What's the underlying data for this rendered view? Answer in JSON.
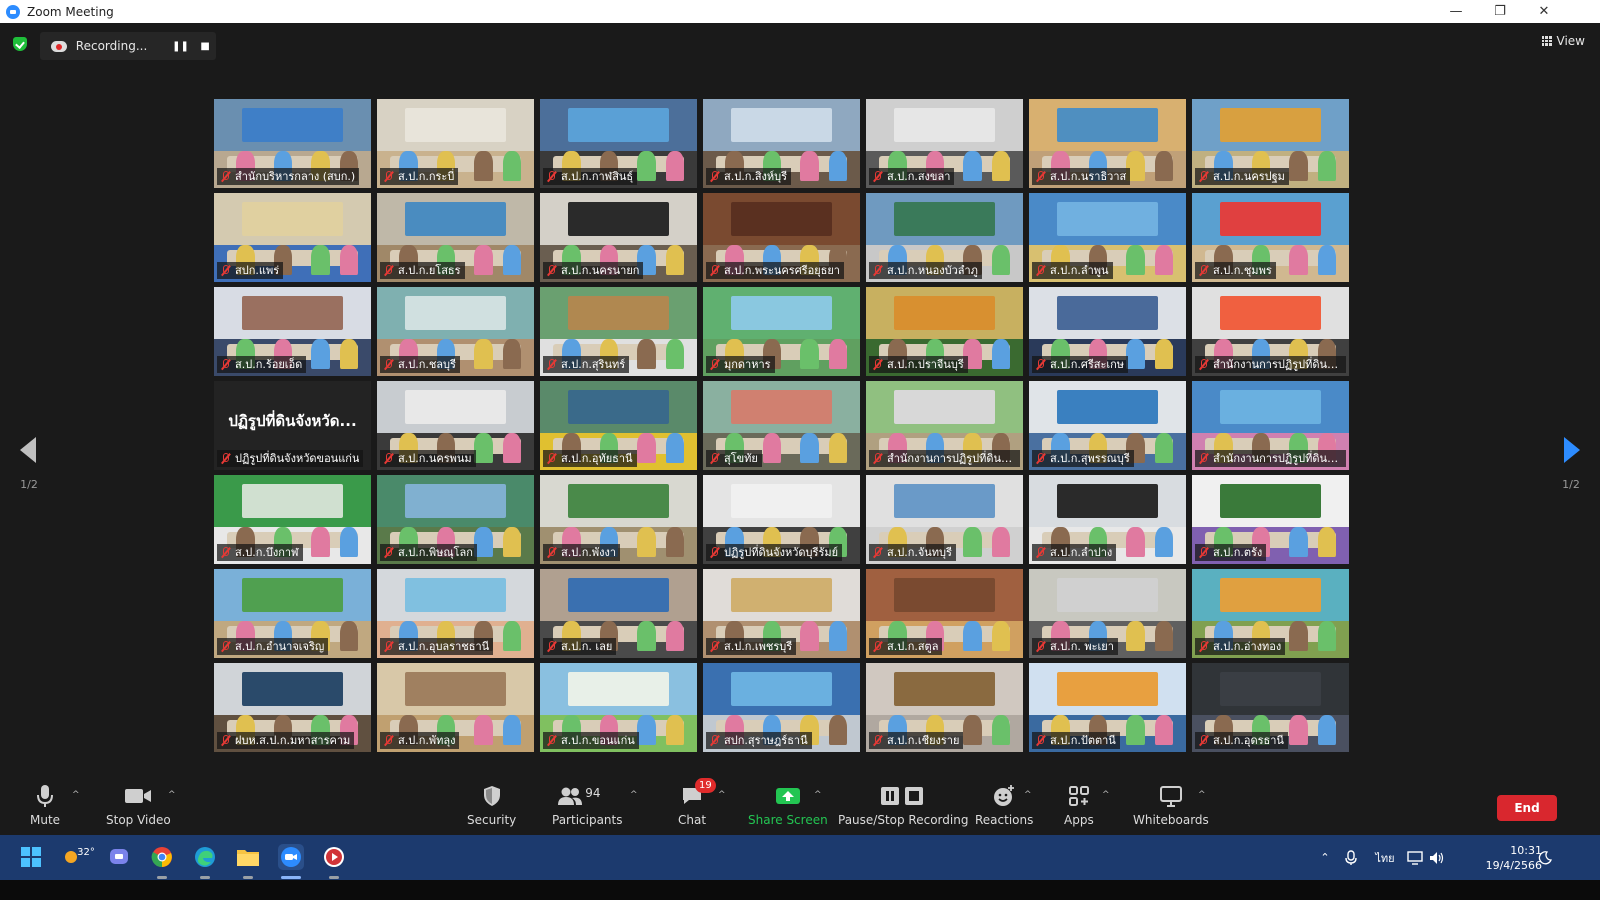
{
  "window": {
    "title": "Zoom Meeting"
  },
  "topbar": {
    "recording_label": "Recording...",
    "view_label": "View"
  },
  "pagination": {
    "left": "1/2",
    "right": "1/2"
  },
  "tiles": [
    {
      "name": "สำนักบริหารกลาง (สบก.)",
      "wall": "#6a8fb0",
      "floor": "#b8a890",
      "banner": "#3f7fc7",
      "active": true
    },
    {
      "name": "ส.ป.ก.กระบี่",
      "wall": "#d8d2c4",
      "floor": "#c9b28e",
      "banner": "#e8e4da"
    },
    {
      "name": "ส.ป.ก.กาฬสินธุ์",
      "wall": "#4c6f9a",
      "floor": "#3a3a3a",
      "banner": "#5aa0d6"
    },
    {
      "name": "ส.ป.ก.สิงห์บุรี",
      "wall": "#8fa8c0",
      "floor": "#6b5a4a",
      "banner": "#c9d8e6"
    },
    {
      "name": "ส.ป.ก.สงขลา",
      "wall": "#cfcfcf",
      "floor": "#5a5a5a",
      "banner": "#e6e6e6"
    },
    {
      "name": "ส.ป.ก.นราธิวาส",
      "wall": "#d8b070",
      "floor": "#c0a078",
      "banner": "#4f8fc0"
    },
    {
      "name": "ส.ป.ก.นครปฐม",
      "wall": "#6fa0c8",
      "floor": "#c0b080",
      "banner": "#d8a040"
    },
    {
      "name": "สปก.แพร่",
      "wall": "#d4cab0",
      "floor": "#3f6fb8",
      "banner": "#e0d0a0"
    },
    {
      "name": "ส.ป.ก.ยโสธร",
      "wall": "#bfb8a8",
      "floor": "#a08868",
      "banner": "#4a8cc0"
    },
    {
      "name": "ส.ป.ก.นครนายก",
      "wall": "#d4d0c8",
      "floor": "#6a5e50",
      "banner": "#2a2a2a"
    },
    {
      "name": "ส.ป.ก.พระนครศรีอยุธยา",
      "wall": "#7a4a30",
      "floor": "#8a6a50",
      "banner": "#5a3020"
    },
    {
      "name": "ส.ป.ก.หนองบัวลำภู",
      "wall": "#6f9ac0",
      "floor": "#c8c8c8",
      "banner": "#3a7a5a"
    },
    {
      "name": "ส.ป.ก.ลำพูน",
      "wall": "#4a8ac8",
      "floor": "#d8c070",
      "banner": "#70b0e0"
    },
    {
      "name": "ส.ป.ก.ชุมพร",
      "wall": "#5aa0d0",
      "floor": "#d0b890",
      "banner": "#e04040"
    },
    {
      "name": "ส.ป.ก.ร้อยเอ็ด",
      "wall": "#d8dce4",
      "floor": "#3a4a6a",
      "banner": "#9a7060"
    },
    {
      "name": "ส.ป.ก.ชลบุรี",
      "wall": "#7fb0b0",
      "floor": "#b09070",
      "banner": "#d0e0e0"
    },
    {
      "name": "ส.ป.ก.สุรินทร์",
      "wall": "#6aa070",
      "floor": "#e0e0e0",
      "banner": "#b08850"
    },
    {
      "name": "มุกดาหาร",
      "wall": "#60b070",
      "floor": "#60a060",
      "banner": "#8ac8e0"
    },
    {
      "name": "ส.ป.ก.ปราจีนบุรี",
      "wall": "#c8b060",
      "floor": "#3a6a30",
      "banner": "#d89030"
    },
    {
      "name": "ส.ป.ก.ศรีสะเกษ",
      "wall": "#dce0e6",
      "floor": "#2a3a5a",
      "banner": "#4a6a9a"
    },
    {
      "name": "สำนักงานการปฏิรูปที่ดินจ...",
      "wall": "#e0e0e0",
      "floor": "#404040",
      "banner": "#f06040"
    },
    {
      "name": "ปฏิรูปที่ดินจังหวัดขอนแก่น",
      "textonly": true,
      "big": "ปฏิรูปที่ดินจังหวัด..."
    },
    {
      "name": "ส.ป.ก.นครพนม",
      "wall": "#c8ccd0",
      "floor": "#3a3a3a",
      "banner": "#e8e8e8"
    },
    {
      "name": "ส.ป.ก.อุทัยธานี",
      "wall": "#5a8a6a",
      "floor": "#e0c030",
      "banner": "#3a6a8a"
    },
    {
      "name": "สุโขทัย",
      "wall": "#8ab0a0",
      "floor": "#6a6a5a",
      "banner": "#d08070"
    },
    {
      "name": "สำนักงานการปฏิรูปที่ดินจ...",
      "wall": "#90c080",
      "floor": "#b0a080",
      "banner": "#d8d8d8"
    },
    {
      "name": "ส.ป.ก.สุพรรณบุรี",
      "wall": "#e0e4e8",
      "floor": "#4a70a0",
      "banner": "#3a80c0"
    },
    {
      "name": "สำนักงานการปฏิรูปที่ดินจ...",
      "wall": "#4a8ac8",
      "floor": "#d080b0",
      "banner": "#6ab0e0"
    },
    {
      "name": "ส.ป.ก.บึงกาฬ",
      "wall": "#3a9a4a",
      "floor": "#e8e8e8",
      "banner": "#d0e0d0"
    },
    {
      "name": "ส.ป.ก.พิษณุโลก",
      "wall": "#4a8a6a",
      "floor": "#5a7a4a",
      "banner": "#80b0d0"
    },
    {
      "name": "ส.ป.ก.พังงา",
      "wall": "#d8d8d0",
      "floor": "#a09070",
      "banner": "#4a8a4a"
    },
    {
      "name": "ปฏิรูปที่ดินจังหวัดบุรีรัมย์",
      "wall": "#e4e4e4",
      "floor": "#404040",
      "banner": "#f0f0f0"
    },
    {
      "name": "ส.ป.ก.จันทบุรี",
      "wall": "#e0e0e0",
      "floor": "#d0d0d0",
      "banner": "#6a9ac8"
    },
    {
      "name": "ส.ป.ก.ลำปาง",
      "wall": "#d8dce0",
      "floor": "#e8e8e8",
      "banner": "#2a2a2a"
    },
    {
      "name": "ส.ป.ก.ตรัง",
      "wall": "#f0f0f0",
      "floor": "#8060b0",
      "banner": "#3a7a3a"
    },
    {
      "name": "ส.ป.ก.อำนาจเจริญ",
      "wall": "#7ab0d8",
      "floor": "#c0a880",
      "banner": "#50a050"
    },
    {
      "name": "ส.ป.ก.อุบลราชธานี",
      "wall": "#d4d8dc",
      "floor": "#e0b090",
      "banner": "#80c0e0"
    },
    {
      "name": "ส.ป.ก. เลย",
      "wall": "#b0a090",
      "floor": "#4a4a4a",
      "banner": "#3a70b0"
    },
    {
      "name": "ส.ป.ก.เพชรบุรี",
      "wall": "#e0dcd8",
      "floor": "#b09070",
      "banner": "#d0b070"
    },
    {
      "name": "ส.ป.ก.สตูล",
      "wall": "#a06040",
      "floor": "#d0a060",
      "banner": "#7a4a30"
    },
    {
      "name": "ส.ป.ก. พะเยา",
      "wall": "#c8c8c0",
      "floor": "#606060",
      "banner": "#d0d0d0"
    },
    {
      "name": "ส.ป.ก.อ่างทอง",
      "wall": "#5ab0c0",
      "floor": "#80a050",
      "banner": "#e0a040"
    },
    {
      "name": "ฝบห.ส.ป.ก.มหาสารคาม",
      "wall": "#d0d4d8",
      "floor": "#605040",
      "banner": "#2a4a6a"
    },
    {
      "name": "ส.ป.ก.พัทลุง",
      "wall": "#d8c8a8",
      "floor": "#c0a070",
      "banner": "#a08060"
    },
    {
      "name": "ส.ป.ก.ขอนแก่น",
      "wall": "#8ac0e0",
      "floor": "#80c060",
      "banner": "#e8f0e8"
    },
    {
      "name": "สปก.สุราษฎร์ธานี",
      "wall": "#3a70b0",
      "floor": "#c0c8d0",
      "banner": "#6ab0e0"
    },
    {
      "name": "ส.ป.ก.เชียงราย",
      "wall": "#d0c8c0",
      "floor": "#b0a8a0",
      "banner": "#8a6a40"
    },
    {
      "name": "ส.ป.ก.ปัตตานี",
      "wall": "#d0e0f0",
      "floor": "#3a6aa0",
      "banner": "#e8a040"
    },
    {
      "name": "ส.ป.ก.อุดรธานี",
      "wall": "#303438",
      "floor": "#4a5060",
      "banner": "#3a3e44"
    }
  ],
  "toolbar": {
    "mute": "Mute",
    "stop_video": "Stop Video",
    "security": "Security",
    "participants": "Participants",
    "participant_count": "94",
    "chat": "Chat",
    "chat_badge": "19",
    "share_screen": "Share Screen",
    "pause_stop_recording": "Pause/Stop Recording",
    "reactions": "Reactions",
    "apps": "Apps",
    "whiteboards": "Whiteboards",
    "end": "End"
  },
  "taskbar": {
    "weather": "32°",
    "language": "ไทย",
    "time": "10:31",
    "date": "19/4/2566"
  }
}
